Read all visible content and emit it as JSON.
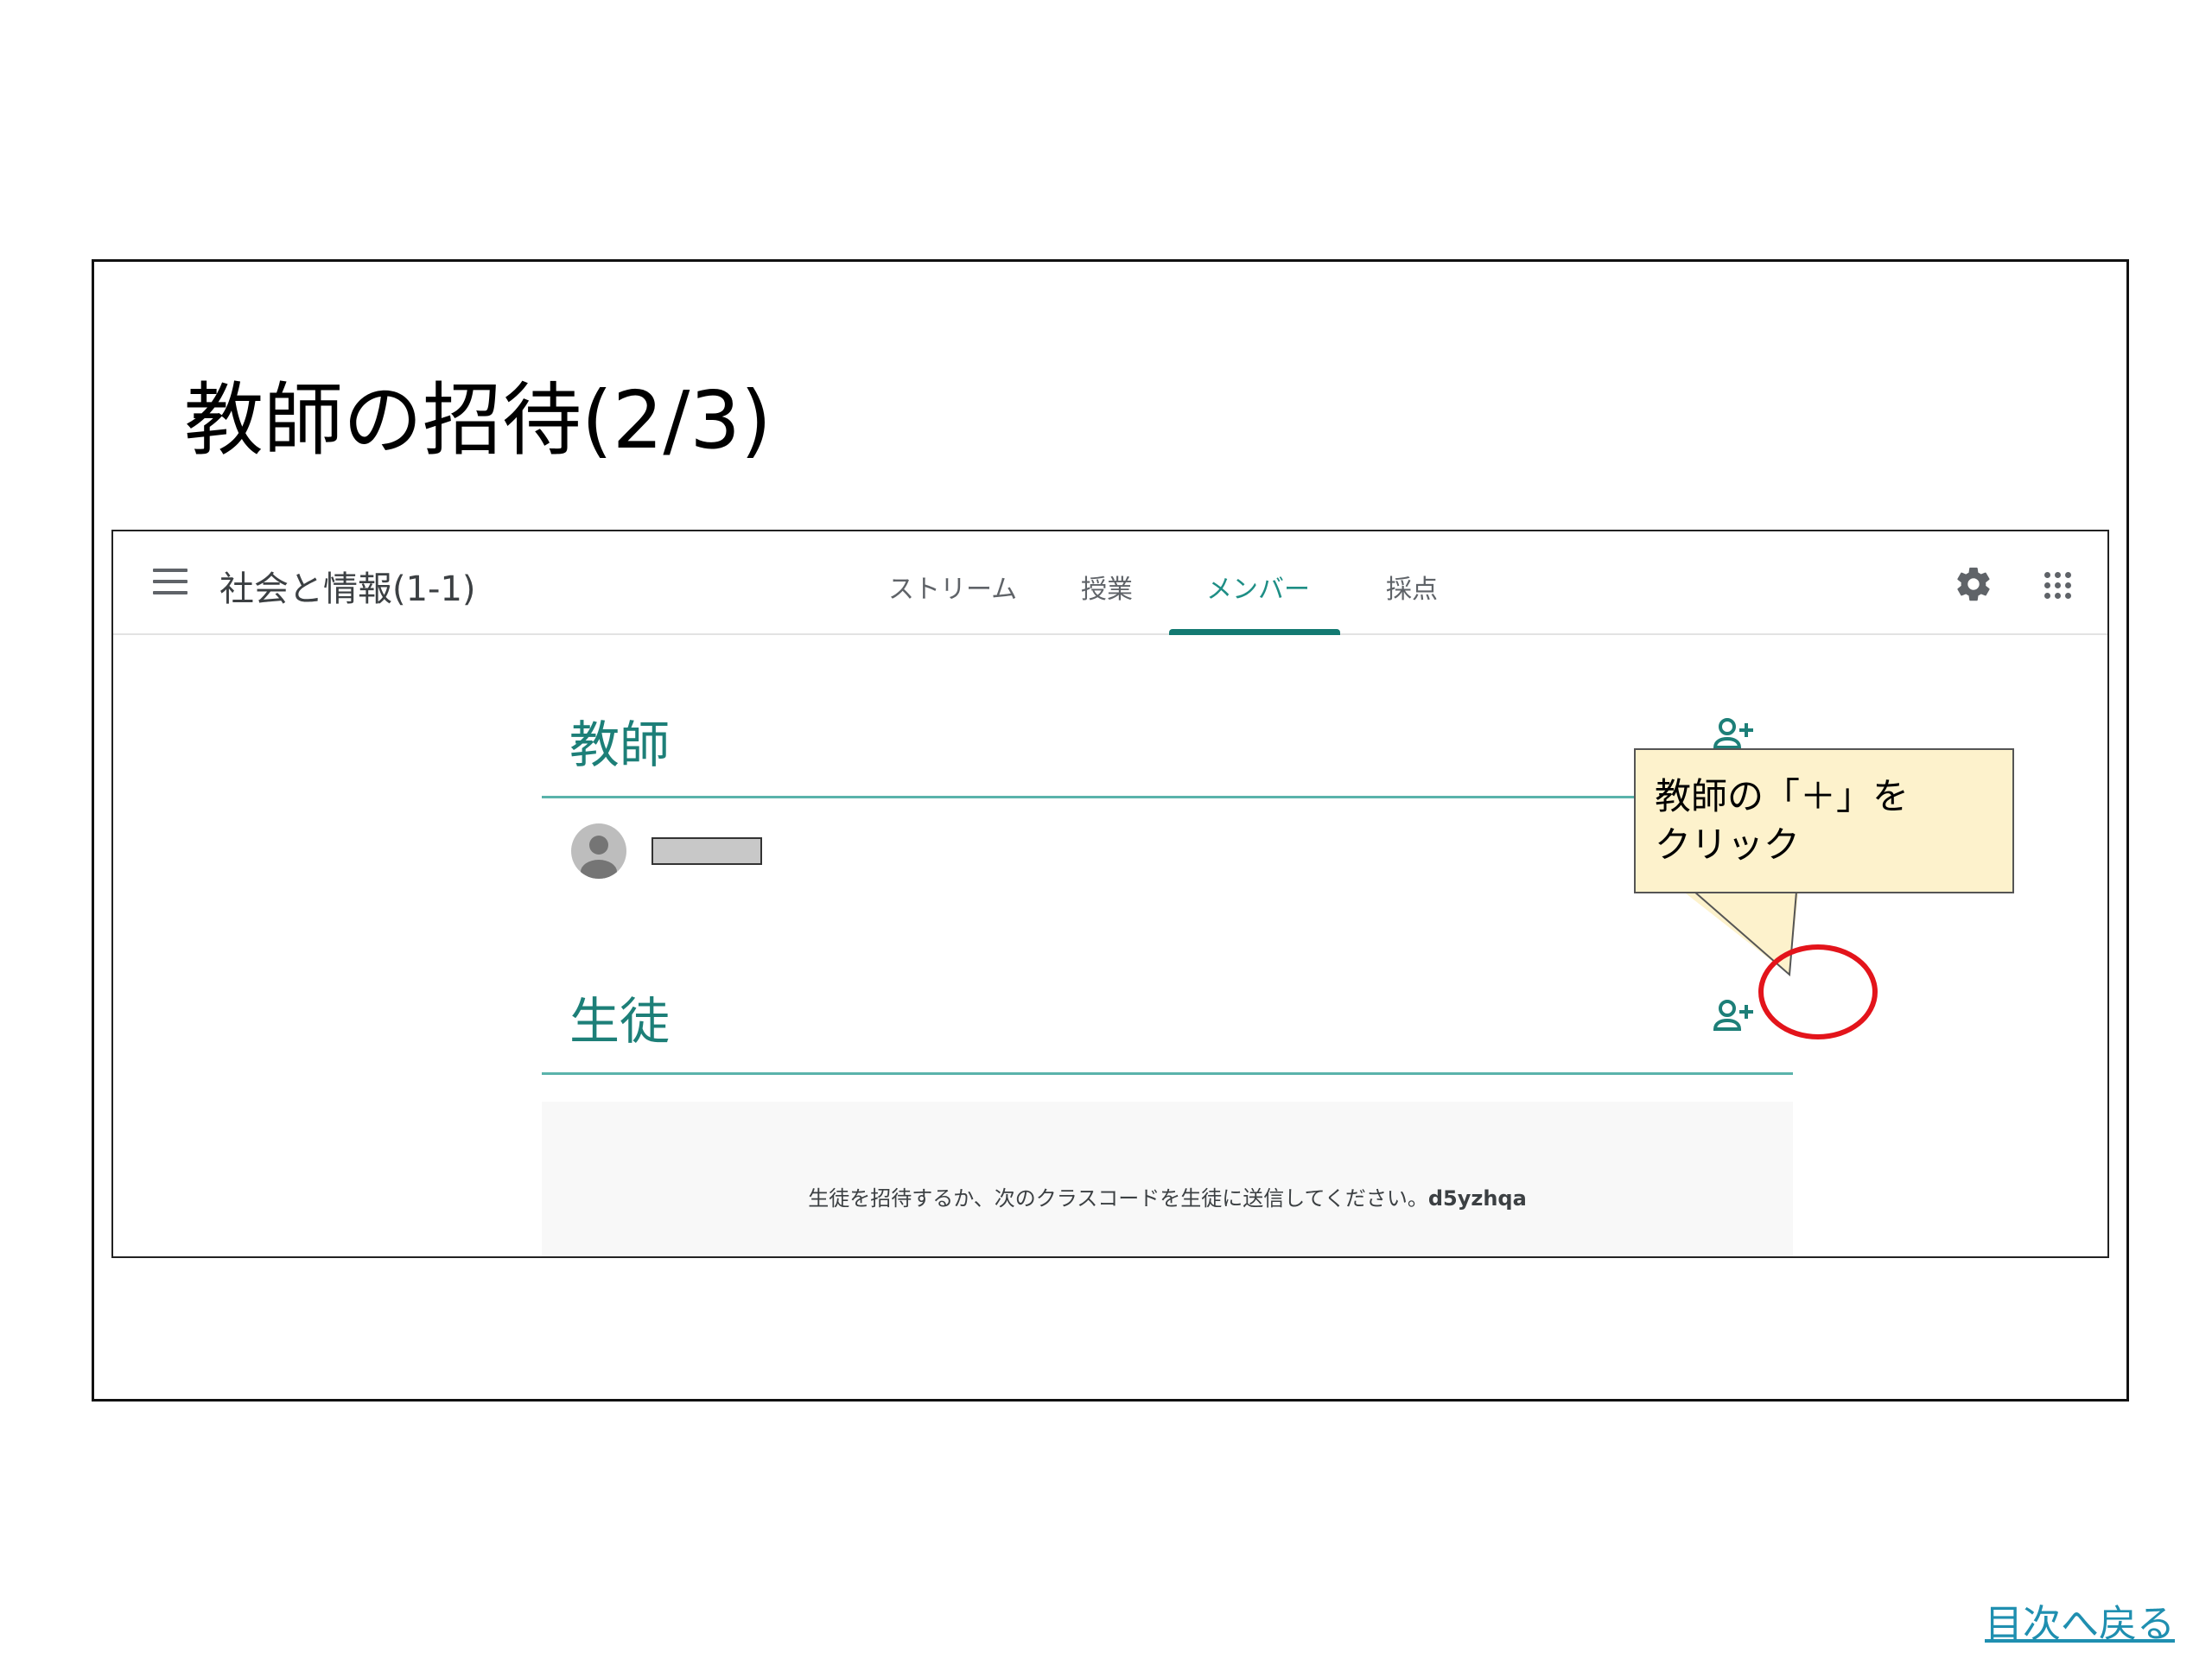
{
  "slide": {
    "title": "教師の招待(2/3)",
    "back_link": "目次へ戻る"
  },
  "classroom": {
    "class_name": "社会と情報(1-1)",
    "tabs": [
      {
        "label": "ストリーム",
        "active": false
      },
      {
        "label": "授業",
        "active": false
      },
      {
        "label": "メンバー",
        "active": true
      },
      {
        "label": "採点",
        "active": false
      }
    ],
    "teachers_heading": "教師",
    "students_heading": "生徒",
    "invite_message": "生徒を招待するか、次のクラスコードを生徒に送信してください。",
    "class_code": "d5yzhqa",
    "accent_color": "#1d7f78"
  },
  "callout": {
    "line1": "教師の「＋」を",
    "line2": "クリック",
    "highlight_color": "#e3141b"
  },
  "icons": [
    "menu-icon",
    "gear-icon",
    "apps-grid-icon",
    "add-person-icon",
    "avatar-icon"
  ]
}
